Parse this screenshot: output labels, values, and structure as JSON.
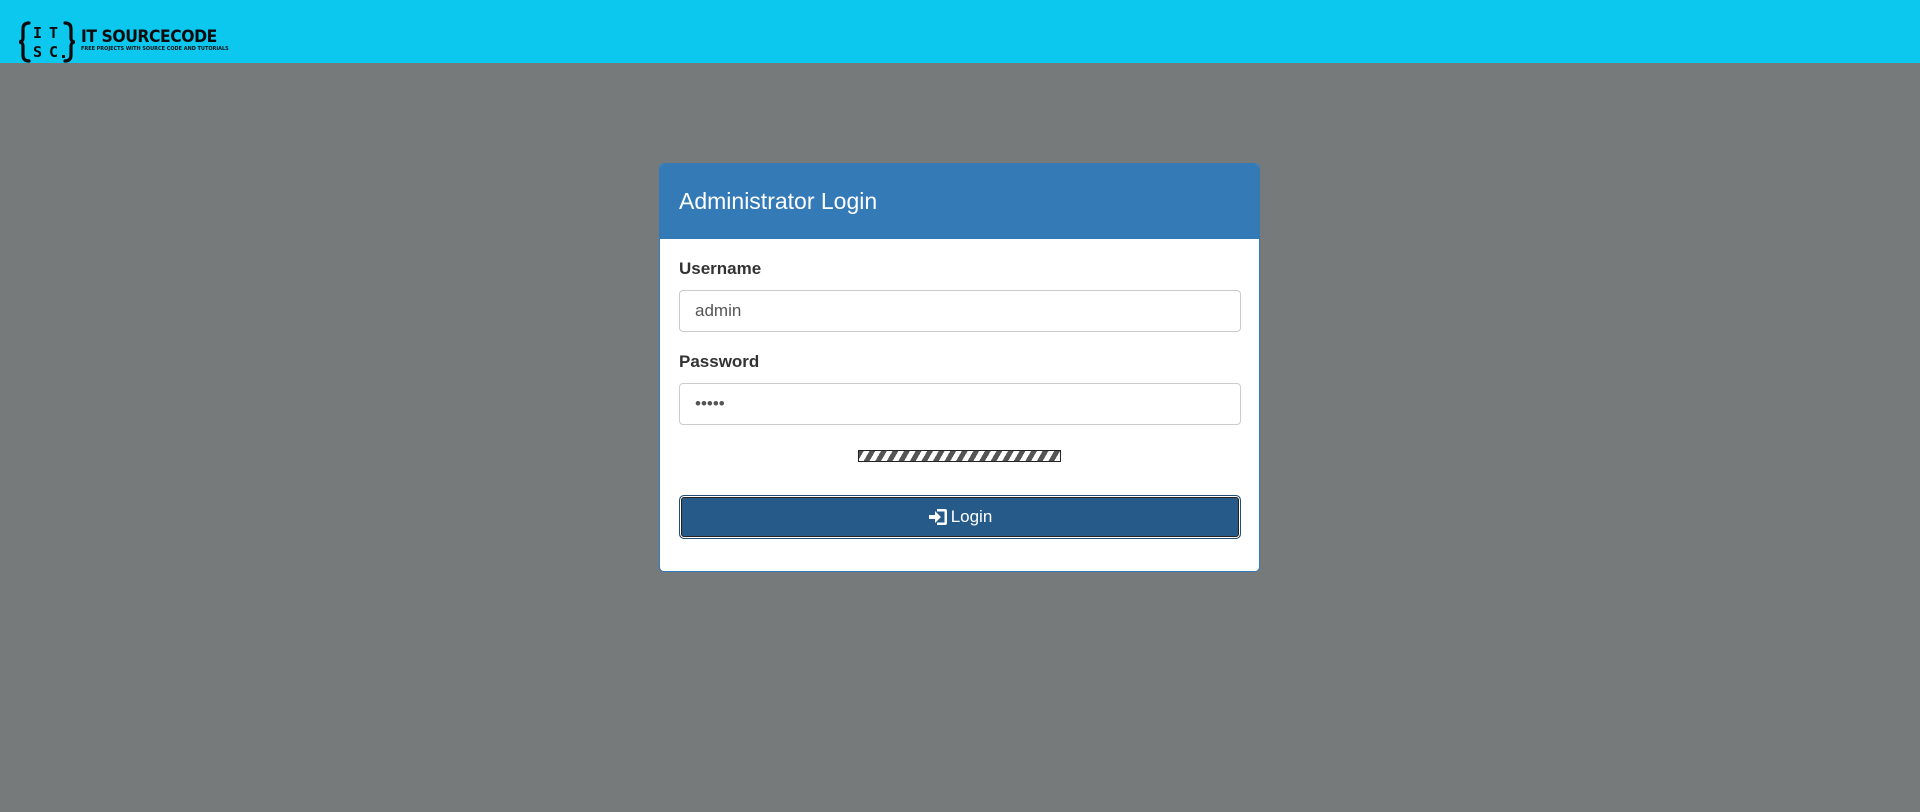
{
  "brand": {
    "title": "IT SOURCECODE",
    "subtitle": "FREE PROJECTS WITH SOURCE CODE AND TUTORIALS",
    "mark_letters": [
      "I",
      "T",
      "S",
      "C"
    ],
    "color": "#0cc7ee"
  },
  "panel": {
    "title": "Administrator Login",
    "accent_color": "#337ab7"
  },
  "form": {
    "username_label": "Username",
    "username_value": "admin",
    "password_label": "Password",
    "password_value": "•••••",
    "submit_label": "Login",
    "submit_icon": "login-icon",
    "button_color": "#265a88"
  },
  "background_color": "#777a7b"
}
